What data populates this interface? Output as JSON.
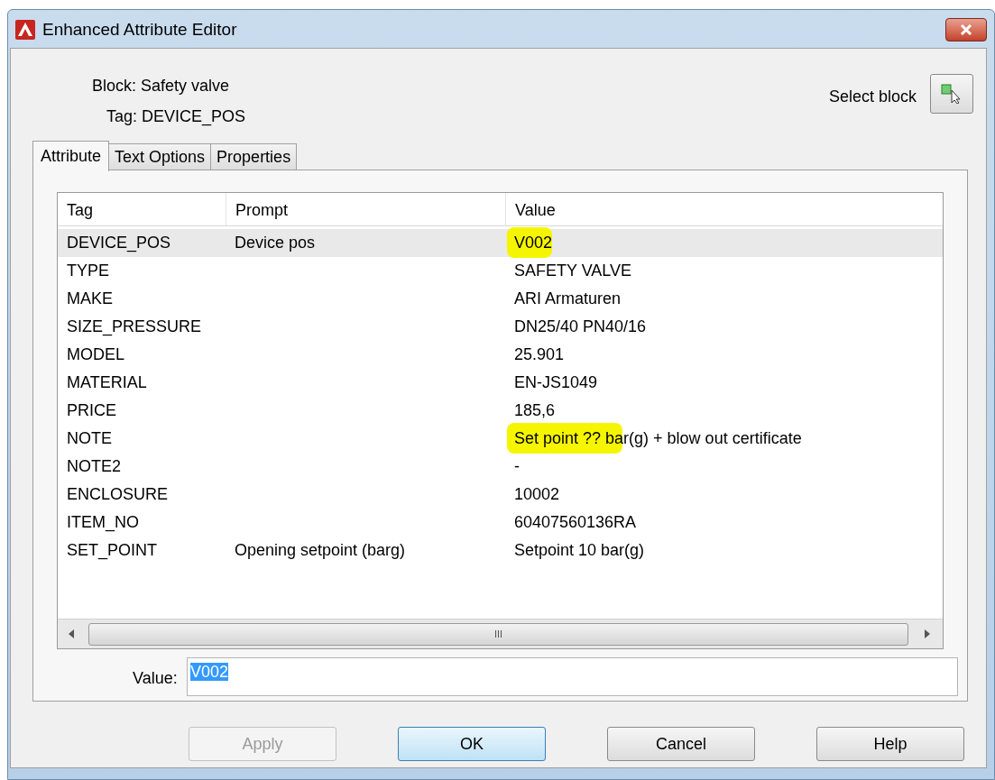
{
  "window": {
    "title": "Enhanced Attribute Editor"
  },
  "block_label": "Block: Safety valve",
  "tag_label": "Tag: DEVICE_POS",
  "select_block": {
    "label": "Select block"
  },
  "tabs": [
    {
      "label": "Attribute",
      "selected": true
    },
    {
      "label": "Text Options",
      "selected": false
    },
    {
      "label": "Properties",
      "selected": false
    }
  ],
  "table": {
    "columns": [
      "Tag",
      "Prompt",
      "Value"
    ],
    "rows": [
      {
        "tag": "DEVICE_POS",
        "prompt": "Device pos",
        "value": "V002",
        "selected": true,
        "highlighted": true
      },
      {
        "tag": "TYPE",
        "value": "SAFETY VALVE",
        "selected": false,
        "highlighted": false
      },
      {
        "tag": "MAKE",
        "value": "ARI Armaturen",
        "selected": false,
        "highlighted": false
      },
      {
        "tag": "SIZE_PRESSURE",
        "value": "DN25/40 PN40/16",
        "selected": false,
        "highlighted": false
      },
      {
        "tag": "MODEL",
        "value": "25.901",
        "selected": false,
        "highlighted": false
      },
      {
        "tag": "MATERIAL",
        "value": "EN-JS1049",
        "selected": false,
        "highlighted": false
      },
      {
        "tag": "PRICE",
        "value": "185,6",
        "selected": false,
        "highlighted": false
      },
      {
        "tag": "NOTE",
        "value": "Set point ?? bar(g) + blow out certificate",
        "selected": false,
        "highlighted": true
      },
      {
        "tag": "NOTE2",
        "value": "-",
        "selected": false,
        "highlighted": false
      },
      {
        "tag": "ENCLOSURE",
        "value": "10002",
        "selected": false,
        "highlighted": false
      },
      {
        "tag": "ITEM_NO",
        "value": "60407560136RA",
        "selected": false,
        "highlighted": false
      },
      {
        "tag": "SET_POINT",
        "prompt": "Opening setpoint (barg)",
        "value": "Setpoint 10 bar(g)",
        "selected": false,
        "highlighted": false
      }
    ]
  },
  "scrollbar_grip": "III",
  "value_field": {
    "label": "Value:",
    "value": "V002"
  },
  "buttons": [
    {
      "label": "Apply",
      "disabled": true,
      "focused": false
    },
    {
      "label": "OK",
      "disabled": false,
      "focused": true
    },
    {
      "label": "Cancel",
      "disabled": false,
      "focused": false
    },
    {
      "label": "Help",
      "disabled": false,
      "focused": false
    }
  ]
}
